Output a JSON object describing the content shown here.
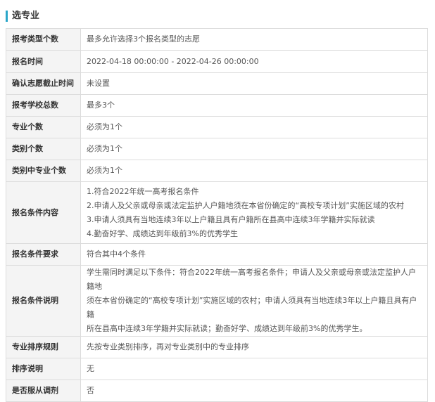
{
  "section": {
    "title": "选专业"
  },
  "rows": [
    {
      "label": "报考类型个数",
      "value": "最多允许选择3个报名类型的志愿"
    },
    {
      "label": "报名时间",
      "value": "2022-04-18 00:00:00 - 2022-04-26 00:00:00"
    },
    {
      "label": "确认志愿截止时间",
      "value": "未设置"
    },
    {
      "label": "报考学校总数",
      "value": "最多3个"
    },
    {
      "label": "专业个数",
      "value": "必须为1个"
    },
    {
      "label": "类别个数",
      "value": "必须为1个"
    },
    {
      "label": "类别中专业个数",
      "value": "必须为1个"
    },
    {
      "label": "报名条件内容",
      "lines": [
        "1.符合2022年统一高考报名条件",
        "2.申请人及父亲或母亲或法定监护人户籍地须在本省份确定的“高校专项计划”实施区域的农村",
        "3.申请人须具有当地连续3年以上户籍且具有户籍所在县高中连续3年学籍并实际就读",
        "4.勤奋好学、成绩达到年级前3%的优秀学生"
      ]
    },
    {
      "label": "报名条件要求",
      "value": "符合其中4个条件"
    },
    {
      "label": "报名条件说明",
      "lines": [
        "学生需同时满足以下条件：符合2022年统一高考报名条件；申请人及父亲或母亲或法定监护人户籍地",
        "须在本省份确定的“高校专项计划”实施区域的农村；申请人须具有当地连续3年以上户籍且具有户籍",
        "所在县高中连续3年学籍并实际就读；勤奋好学、成绩达到年级前3%的优秀学生。"
      ]
    },
    {
      "label": "专业排序规则",
      "value": "先按专业类别排序，再对专业类别中的专业排序"
    },
    {
      "label": "排序说明",
      "value": "无"
    },
    {
      "label": "是否服从调剂",
      "value": "否"
    }
  ]
}
